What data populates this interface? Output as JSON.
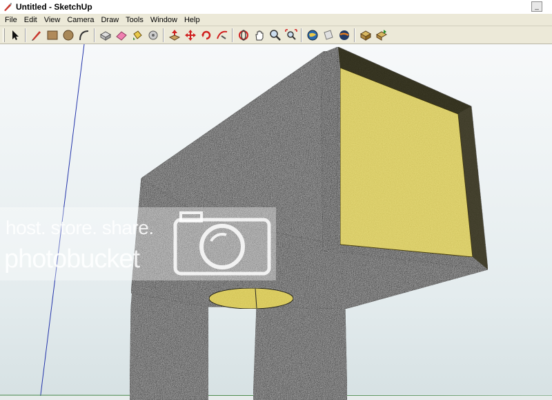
{
  "window": {
    "title": "Untitled - SketchUp",
    "app_icon": "sketchup-logo-icon",
    "minimize_glyph": "_"
  },
  "menu": [
    "File",
    "Edit",
    "View",
    "Camera",
    "Draw",
    "Tools",
    "Window",
    "Help"
  ],
  "toolbar": {
    "tools": [
      "select-arrow-icon",
      "pencil-line-icon",
      "rectangle-icon",
      "circle-icon",
      "arc-icon",
      "make-component-icon",
      "eraser-icon",
      "paint-bucket-icon",
      "tape-measure-icon",
      "push-pull-icon",
      "move-icon",
      "rotate-icon",
      "follow-me-icon",
      "orbit-icon",
      "pan-hand-icon",
      "zoom-icon",
      "zoom-extents-icon",
      "get-models-icon",
      "share-model-icon",
      "google-earth-icon",
      "component-library-icon",
      "share-component-icon"
    ]
  },
  "watermark": {
    "line1": "host. store. share.",
    "line2": "photobucket"
  },
  "colors": {
    "sky_top": "#f7f9fa",
    "sky_bottom": "#d6e1e3",
    "carpet": "#3a3a3a",
    "foam": "#e8dc7a",
    "blue_axis": "#2233aa",
    "green_axis": "#4c8c4c"
  }
}
